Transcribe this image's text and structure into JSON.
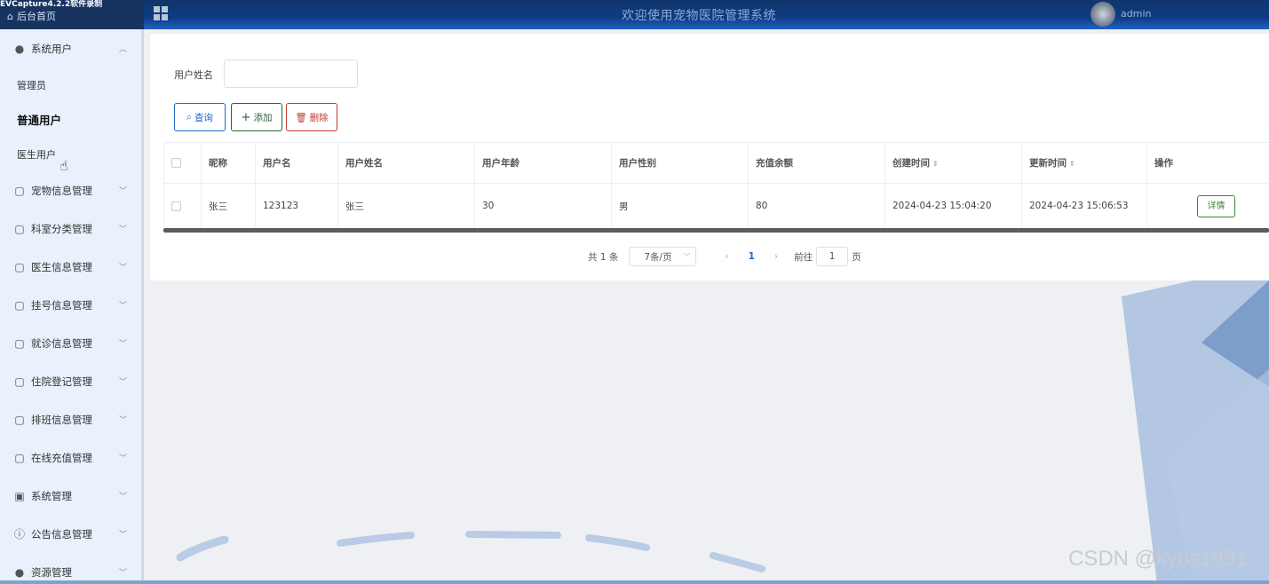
{
  "recorder_watermark": "EVCapture4.2.2软件录制",
  "header": {
    "home_label": "后台首页",
    "title": "欢迎使用宠物医院管理系统",
    "user": "admin"
  },
  "sidebar": {
    "items": [
      {
        "label": "系统用户",
        "icon": "user-icon",
        "expanded": true,
        "children": [
          "管理员",
          "普通用户",
          "医生用户"
        ],
        "active_child": "普通用户"
      },
      {
        "label": "宠物信息管理",
        "icon": "folder-icon"
      },
      {
        "label": "科室分类管理",
        "icon": "folder-icon"
      },
      {
        "label": "医生信息管理",
        "icon": "folder-icon"
      },
      {
        "label": "挂号信息管理",
        "icon": "folder-icon"
      },
      {
        "label": "就诊信息管理",
        "icon": "folder-icon"
      },
      {
        "label": "住院登记管理",
        "icon": "folder-icon"
      },
      {
        "label": "排班信息管理",
        "icon": "folder-icon"
      },
      {
        "label": "在线充值管理",
        "icon": "folder-icon"
      },
      {
        "label": "系统管理",
        "icon": "picture-icon"
      },
      {
        "label": "公告信息管理",
        "icon": "info-icon"
      },
      {
        "label": "资源管理",
        "icon": "location-icon"
      }
    ]
  },
  "search": {
    "label": "用户姓名",
    "value": "",
    "query_label": "查询",
    "add_label": "添加",
    "delete_label": "删除"
  },
  "table": {
    "columns": [
      "昵称",
      "用户名",
      "用户姓名",
      "用户年龄",
      "用户性别",
      "充值余额",
      "创建时间",
      "更新时间",
      "操作"
    ],
    "rows": [
      {
        "nickname": "张三",
        "username": "123123",
        "realname": "张三",
        "age": "30",
        "gender": "男",
        "balance": "80",
        "created": "2024-04-23 15:04:20",
        "updated": "2024-04-23 15:06:53",
        "action": "详情"
      }
    ]
  },
  "pagination": {
    "total": "共 1 条",
    "page_size": "7条/页",
    "current": "1",
    "goto_prefix": "前往",
    "goto_value": "1",
    "goto_suffix": "页"
  },
  "footer_watermark": "CSDN @kybs1991"
}
